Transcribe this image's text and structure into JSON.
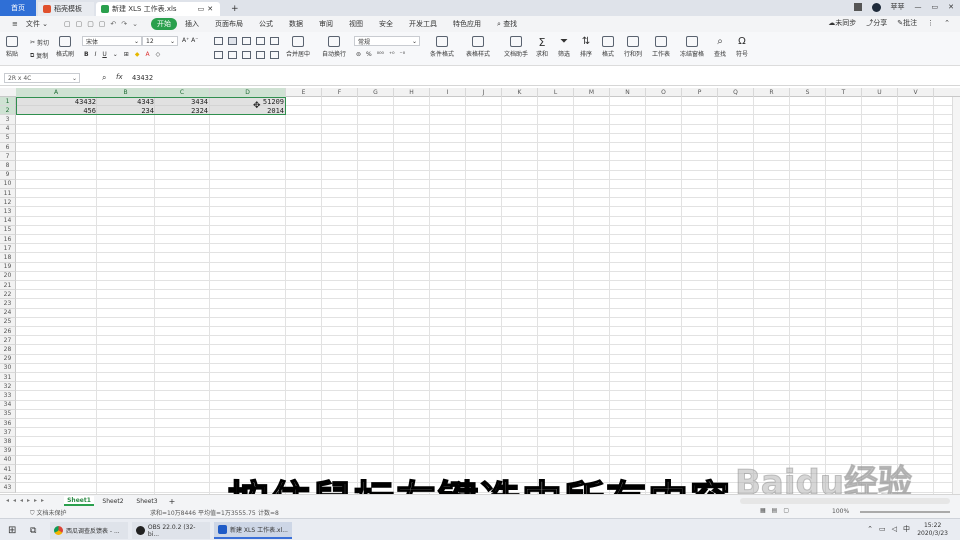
{
  "tabs": {
    "home": "首页",
    "template": "稻壳模板",
    "doc": "新建 XLS 工作表.xls",
    "new_tab": "+"
  },
  "user": "苹苹",
  "menu": {
    "file": "文件",
    "items": [
      "开始",
      "插入",
      "页面布局",
      "公式",
      "数据",
      "审阅",
      "视图",
      "安全",
      "开发工具",
      "特色应用"
    ],
    "search": "查找",
    "sync": "未同步",
    "share": "分享",
    "comment": "批注"
  },
  "ribbon": {
    "paste": "粘贴",
    "cut": "剪切",
    "copy": "复制",
    "format_painter": "格式刷",
    "font_name": "宋体",
    "font_size": "12",
    "bold": "B",
    "italic": "I",
    "underline": "U",
    "merge": "合并居中",
    "wrap": "自动换行",
    "number_format": "常规",
    "percent": "%",
    "conditional": "条件格式",
    "table_style": "表格样式",
    "doc_helper": "文档助手",
    "sum": "求和",
    "filter": "筛选",
    "sort": "排序",
    "format": "格式",
    "rowcol": "行和列",
    "worksheet": "工作表",
    "freeze": "冻结窗格",
    "find": "查找",
    "symbol": "符号"
  },
  "formula_bar": {
    "name_box": "2R x 4C",
    "fx": "fx",
    "value": "43432"
  },
  "columns": [
    "A",
    "B",
    "C",
    "D",
    "E",
    "F",
    "G",
    "H",
    "I",
    "J",
    "K",
    "L",
    "M",
    "N",
    "O",
    "P",
    "Q",
    "R",
    "S",
    "T",
    "U",
    "V"
  ],
  "rows": [
    "1",
    "2",
    "3",
    "4",
    "5",
    "6",
    "7",
    "8",
    "9",
    "10",
    "11",
    "12",
    "13",
    "14",
    "15",
    "16",
    "17",
    "18",
    "19",
    "20",
    "21",
    "22",
    "23",
    "24",
    "25",
    "26",
    "27",
    "28",
    "29",
    "30",
    "31",
    "32",
    "33",
    "34",
    "35",
    "36",
    "37",
    "38",
    "39",
    "40",
    "41",
    "42",
    "43"
  ],
  "cells": {
    "a1": "43432",
    "b1": "4343",
    "c1": "3434",
    "d1": "51209",
    "a2": "456",
    "b2": "234",
    "c2": "2324",
    "d2": "2014"
  },
  "sheets": [
    "Sheet1",
    "Sheet2",
    "Sheet3"
  ],
  "status": {
    "protect": "文档未保护",
    "sum": "求和=10万8446",
    "avg": "平均值=1万3555.75",
    "count": "计数=8",
    "zoom": "100%"
  },
  "taskbar": {
    "app1": "西瓜调查反馈表 - ...",
    "app2": "OBS 22.0.2 (32-bi...",
    "app3": "新建 XLS 工作表.xl...",
    "time": "15:22",
    "date": "2020/3/23"
  },
  "subtitle": "按住鼠标左键选中所有内容",
  "watermark": "Baidu经验",
  "colors": {
    "accent": "#2aa04d",
    "selection_border": "#2f8f4e"
  }
}
